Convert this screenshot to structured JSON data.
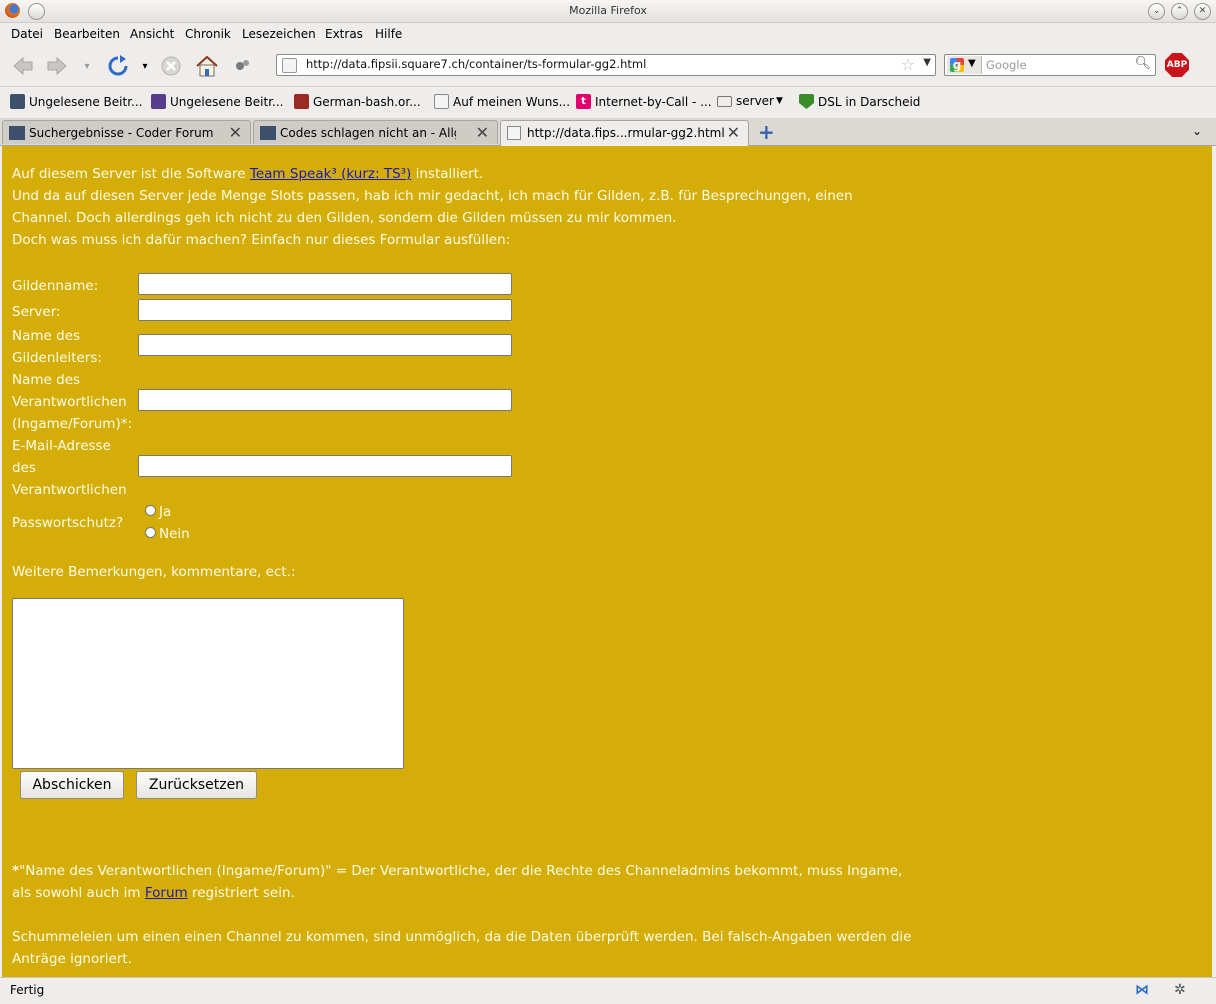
{
  "window": {
    "title": "Mozilla Firefox"
  },
  "menu": [
    "Datei",
    "Bearbeiten",
    "Ansicht",
    "Chronik",
    "Lesezeichen",
    "Extras",
    "Hilfe"
  ],
  "nav": {
    "url": "http://data.fipsii.square7.ch/container/ts-formular-gg2.html",
    "search_placeholder": "Google",
    "adblock_label": "ABP"
  },
  "bookmarks": [
    {
      "label": "Ungelesene Beitr...",
      "icon": "forum-icon",
      "color": "#3c4f6b"
    },
    {
      "label": "Ungelesene Beitr...",
      "icon": "forum-icon",
      "color": "#5a3c8c"
    },
    {
      "label": "German-bash.or...",
      "icon": "bash-icon",
      "color": "#9a2a22"
    },
    {
      "label": "Auf meinen Wuns...",
      "icon": "page-icon",
      "color": "#888888"
    },
    {
      "label": "Internet-by-Call - ...",
      "icon": "t-icon",
      "color": "#e2006f"
    },
    {
      "label": "server",
      "icon": "folder-icon",
      "color": "#7a7a6a"
    },
    {
      "label": "DSL in Darscheid",
      "icon": "shield-icon",
      "color": "#3a8a2a"
    }
  ],
  "tabs": [
    {
      "label": "Suchergebnisse - Coder Forum",
      "active": false
    },
    {
      "label": "Codes schlagen nicht an - Allge...",
      "active": false
    },
    {
      "label": "http://data.fips...rmular-gg2.html",
      "active": true
    }
  ],
  "page": {
    "intro_1_before": "Auf diesem Server ist die Software ",
    "intro_link": "Team Speak³ (kurz: TS³)",
    "intro_1_after": " installiert.",
    "intro_2": "Und da auf diesen Server jede Menge Slots passen, hab ich mir gedacht, ich mach für Gilden, z.B. für Besprechungen, einen",
    "intro_3": "Channel. Doch allerdings geh ich nicht zu den Gilden, sondern die Gilden müssen zu mir kommen.",
    "intro_4": "Doch was muss ich dafür machen? Einfach nur dieses Formular ausfüllen:",
    "labels": {
      "guild": "Gildenname:",
      "server": "Server:",
      "leader_1": "Name des",
      "leader_2": "Gildenleiters:",
      "resp_1": "Name des",
      "resp_2": "Verantwortlichen",
      "resp_3": "(Ingame/Forum)*:",
      "email_1": "E-Mail-Adresse",
      "email_2": "des",
      "email_3": "Verantwortlichen",
      "password": "Passwortschutz?",
      "yes": "Ja",
      "no": "Nein",
      "remarks": "Weitere Bemerkungen, kommentare, ect.:"
    },
    "buttons": {
      "submit": "Abschicken",
      "reset": "Zurücksetzen"
    },
    "note_star": "*",
    "note_1": "\"Name des Verantwortlichen (Ingame/Forum)\" = Der Verantwortliche, der die Rechte des Channeladmins bekommt, muss Ingame,",
    "note_2_before": "als sowohl auch im ",
    "note_link": "Forum",
    "note_2_after": " registriert sein.",
    "warn_1": "Schummeleien um einen einen Channel zu kommen, sind unmöglich, da die Daten überprüft werden. Bei falsch-Angaben werden die",
    "warn_2": "Anträge ignoriert."
  },
  "status": {
    "text": "Fertig"
  },
  "colors": {
    "page_bg": "#d4ad08",
    "page_text": "#fffde6",
    "link": "#1a1ab3"
  }
}
